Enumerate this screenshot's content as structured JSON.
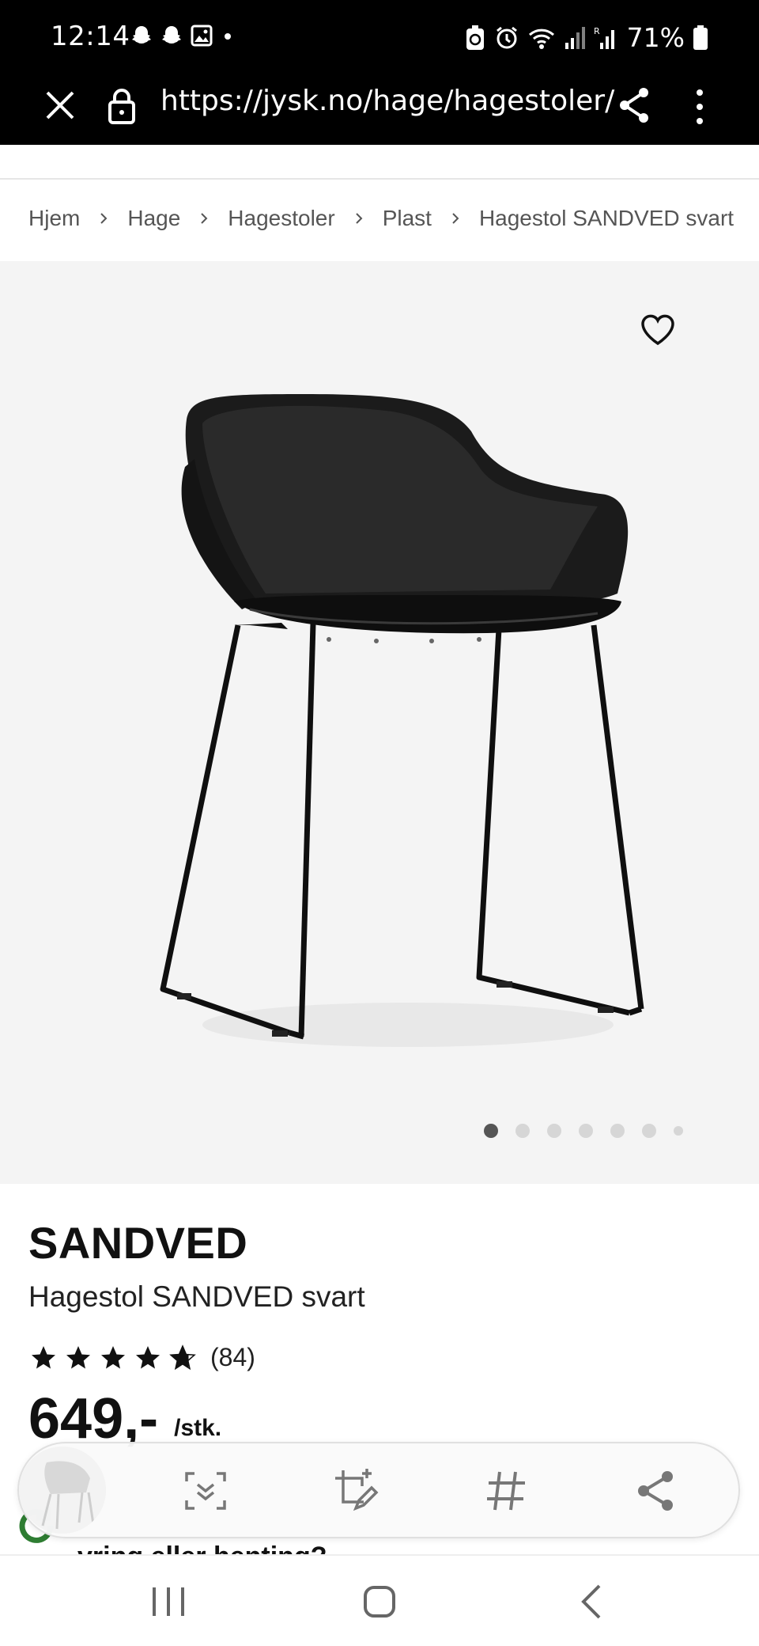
{
  "status_bar": {
    "time": "12:14",
    "battery": "71%",
    "left_icons": [
      "snapchat-icon",
      "snapchat-icon",
      "gallery-icon",
      "dot-icon"
    ],
    "right_icons": [
      "battery-saver-icon",
      "alarm-icon",
      "wifi-icon",
      "signal-icon",
      "signal-roaming-icon",
      "battery-icon"
    ]
  },
  "browser": {
    "url": "https://jysk.no/hage/hagestoler/"
  },
  "breadcrumb": [
    "Hjem",
    "Hage",
    "Hagestoler",
    "Plast",
    "Hagestol SANDVED svart"
  ],
  "gallery": {
    "image_count_dots": 7,
    "active_index": 0
  },
  "product": {
    "brand": "SANDVED",
    "name": "Hagestol SANDVED svart",
    "rating_stars": 4.7,
    "rating_count": "(84)",
    "price": "649,-",
    "price_unit": "/stk."
  },
  "delivery": {
    "text": "vring eller henting?"
  },
  "colors": {
    "bar_black": "#000000",
    "image_bg": "#f4f4f4",
    "accent_green": "#2e7d32"
  }
}
